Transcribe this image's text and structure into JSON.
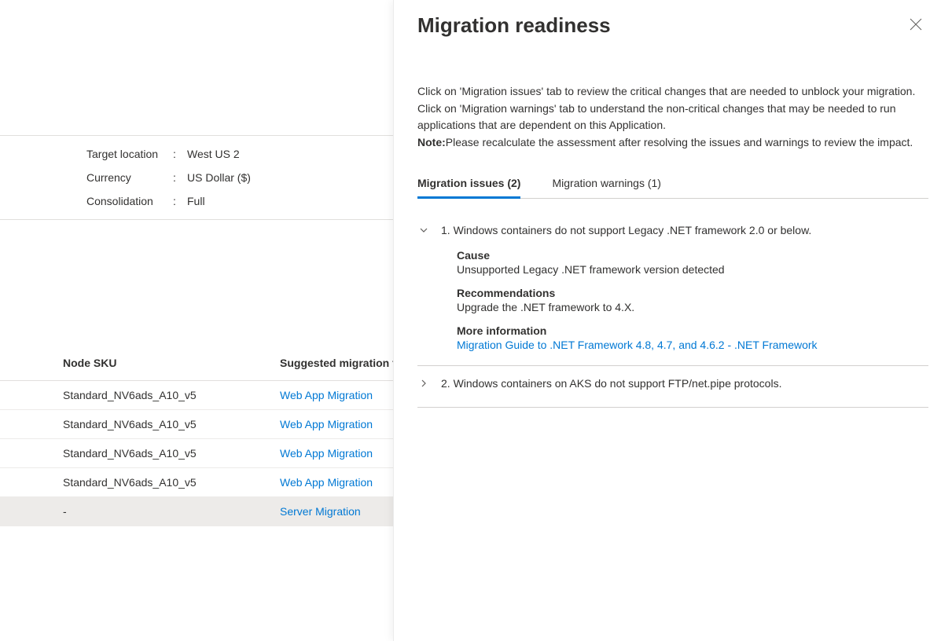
{
  "metadata": {
    "target_location_label": "Target location",
    "target_location_value": "West US 2",
    "currency_label": "Currency",
    "currency_value": "US Dollar ($)",
    "consolidation_label": "Consolidation",
    "consolidation_value": "Full"
  },
  "table": {
    "col_sku": "Node SKU",
    "col_tool": "Suggested migration tool",
    "rows": [
      {
        "sku": "Standard_NV6ads_A10_v5",
        "tool": "Web App Migration"
      },
      {
        "sku": "Standard_NV6ads_A10_v5",
        "tool": "Web App Migration"
      },
      {
        "sku": "Standard_NV6ads_A10_v5",
        "tool": "Web App Migration"
      },
      {
        "sku": "Standard_NV6ads_A10_v5",
        "tool": "Web App Migration"
      },
      {
        "sku": "-",
        "tool": "Server Migration"
      }
    ]
  },
  "panel": {
    "title": "Migration readiness",
    "desc_main": "Click on 'Migration issues' tab to review the critical changes that are needed to unblock your migration. Click on 'Migration warnings' tab to understand the non-critical changes that may be needed to run applications that are dependent on this Application.",
    "note_label": "Note:",
    "note_text": "Please recalculate the assessment after resolving the issues and warnings to review the impact.",
    "tabs": {
      "issues": "Migration issues (2)",
      "warnings": "Migration warnings (1)"
    },
    "issues": [
      {
        "title": "1. Windows containers do not support Legacy .NET framework 2.0 or below.",
        "cause_label": "Cause",
        "cause_text": "Unsupported Legacy .NET framework version detected",
        "rec_label": "Recommendations",
        "rec_text": "Upgrade the .NET framework to 4.X.",
        "more_label": "More information",
        "more_link": "Migration Guide to .NET Framework 4.8, 4.7, and 4.6.2 - .NET Framework"
      },
      {
        "title": "2. Windows containers on AKS do not support FTP/net.pipe protocols."
      }
    ]
  }
}
